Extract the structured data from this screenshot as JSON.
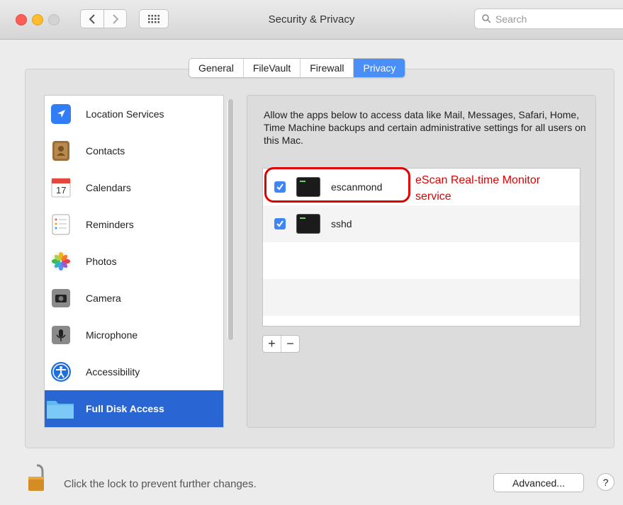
{
  "window": {
    "title": "Security & Privacy"
  },
  "search": {
    "placeholder": "Search"
  },
  "tabs": [
    {
      "label": "General"
    },
    {
      "label": "FileVault"
    },
    {
      "label": "Firewall"
    },
    {
      "label": "Privacy",
      "active": true
    }
  ],
  "sidebar": {
    "items": [
      {
        "label": "Location Services",
        "icon": "location-arrow-icon"
      },
      {
        "label": "Contacts",
        "icon": "contacts-book-icon"
      },
      {
        "label": "Calendars",
        "icon": "calendar-icon",
        "icon_text": "17"
      },
      {
        "label": "Reminders",
        "icon": "reminders-list-icon"
      },
      {
        "label": "Photos",
        "icon": "photos-flower-icon"
      },
      {
        "label": "Camera",
        "icon": "camera-icon"
      },
      {
        "label": "Microphone",
        "icon": "microphone-icon"
      },
      {
        "label": "Accessibility",
        "icon": "accessibility-icon"
      },
      {
        "label": "Full Disk Access",
        "icon": "folder-icon",
        "selected": true
      }
    ]
  },
  "main": {
    "description": "Allow the apps below to access data like Mail, Messages, Safari, Home, Time Machine backups and certain administrative settings for all users on this Mac.",
    "apps": [
      {
        "name": "escanmond",
        "checked": true
      },
      {
        "name": "sshd",
        "checked": true
      }
    ],
    "annotation_line1": "eScan Real-time Monitor",
    "annotation_line2": "service",
    "annotation_color": "#e00000",
    "add_label": "+",
    "remove_label": "−"
  },
  "footer": {
    "lock_text": "Click the lock to prevent further changes.",
    "advanced_label": "Advanced...",
    "help_label": "?"
  },
  "colors": {
    "accent": "#4a8ff7",
    "selection": "#2a66d3"
  }
}
